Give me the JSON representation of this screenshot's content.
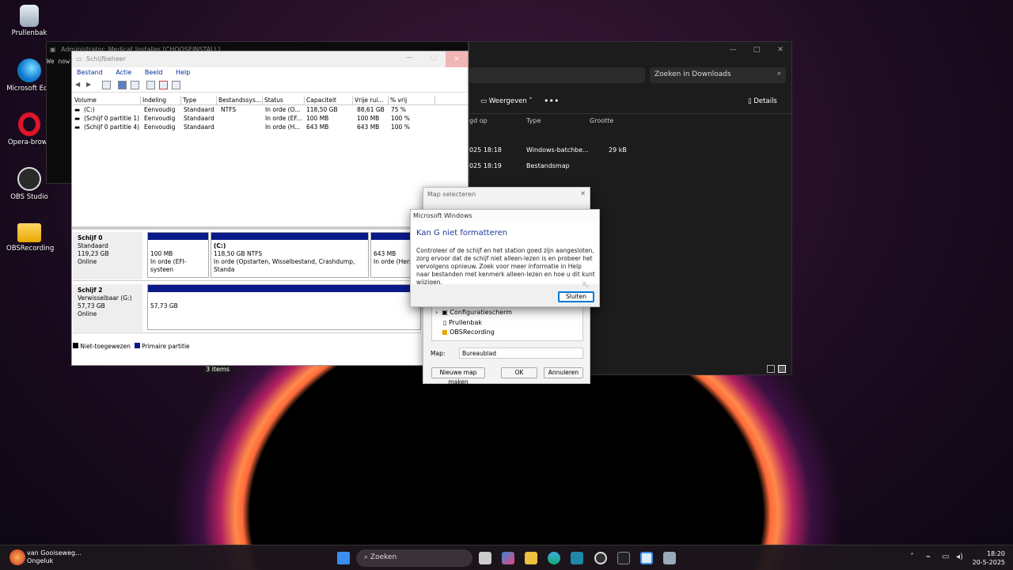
{
  "desktop": {
    "icons": [
      {
        "label": "Prullenbak",
        "icon": "recycle-bin-icon"
      },
      {
        "label": "Microsoft Edg",
        "icon": "edge-icon"
      },
      {
        "label": "Opera-brows",
        "icon": "opera-icon"
      },
      {
        "label": "OBS Studio",
        "icon": "obs-icon"
      },
      {
        "label": "OBSRecording",
        "icon": "folder-icon"
      }
    ]
  },
  "cmd": {
    "title": "Administrator: Medicat Installer [CHOOSEINSTALL]",
    "line": "We now"
  },
  "explorer": {
    "search_placeholder": "Zoeken in Downloads",
    "view_label": "Weergeven",
    "details_label": "Details",
    "columns": [
      "gd op",
      "Type",
      "Grootte"
    ],
    "rows": [
      {
        "date": "025 18:18",
        "type": "Windows-batchbe...",
        "size": "29 kB"
      },
      {
        "date": "025 18:19",
        "type": "Bestandsmap",
        "size": ""
      }
    ],
    "status": "3 items"
  },
  "diskmgmt": {
    "title": "Schijfbeheer",
    "menu": [
      "Bestand",
      "Actie",
      "Beeld",
      "Help"
    ],
    "columns": [
      "Volume",
      "Indeling",
      "Type",
      "Bestandssys...",
      "Status",
      "Capaciteit",
      "Vrije rui...",
      "% vrij"
    ],
    "volumes": [
      {
        "volume": "(C:)",
        "layout": "Eenvoudig",
        "type": "Standaard",
        "fs": "NTFS",
        "status": "In orde (O...",
        "capacity": "118,50 GB",
        "free": "88,61 GB",
        "pct": "75 %"
      },
      {
        "volume": "(Schijf 0 partitie 1)",
        "layout": "Eenvoudig",
        "type": "Standaard",
        "fs": "",
        "status": "In orde (EF...",
        "capacity": "100 MB",
        "free": "100 MB",
        "pct": "100 %"
      },
      {
        "volume": "(Schijf 0 partitie 4)",
        "layout": "Eenvoudig",
        "type": "Standaard",
        "fs": "",
        "status": "In orde (H...",
        "capacity": "643 MB",
        "free": "643 MB",
        "pct": "100 %"
      }
    ],
    "disk0": {
      "name": "Schijf 0",
      "kind": "Standaard",
      "size": "119,23 GB",
      "state": "Online",
      "p1_size": "100 MB",
      "p1_status": "In orde (EFI-systeen",
      "p2_name": "(C:)",
      "p2_size": "118,50 GB NTFS",
      "p2_status": "In orde (Opstarten, Wisselbestand, Crashdump, Standa",
      "p3_size": "643 MB",
      "p3_status": "In orde (Hers"
    },
    "disk2": {
      "name": "Schijf 2",
      "kind": "Verwisselbaar (G:)",
      "size": "57,73 GB",
      "state": "Online",
      "p1_size": "57,73 GB"
    },
    "legend": [
      "Niet-toegewezen",
      "Primaire partitie"
    ],
    "legend_colors": [
      "#000000",
      "#0a1a8a"
    ]
  },
  "folder_dialog": {
    "title": "Map selecteren",
    "tree": [
      "Configuratiescherm",
      "Prullenbak",
      "OBSRecording"
    ],
    "folder_label": "Map:",
    "folder_value": "Bureaublad",
    "new_folder": "Nieuwe map maken",
    "ok": "OK",
    "cancel": "Annuleren"
  },
  "error_dialog": {
    "title": "Microsoft Windows",
    "heading": "Kan G niet formatteren",
    "message": "Controleer of de schijf en het station goed zijn aangesloten, zorg ervoor dat de schijf niet alleen-lezen is en probeer het vervolgens opnieuw. Zoek voor meer informatie in Help naar bestanden met kenmerk alleen-lezen en hoe u dit kunt wijzigen.",
    "close": "Sluiten"
  },
  "taskbar": {
    "weather_title": "van Gooiseweg...",
    "weather_sub": "Ongeluk",
    "search": "Zoeken",
    "time": "18:20",
    "date": "20-5-2025",
    "accent": "#0078d4"
  }
}
